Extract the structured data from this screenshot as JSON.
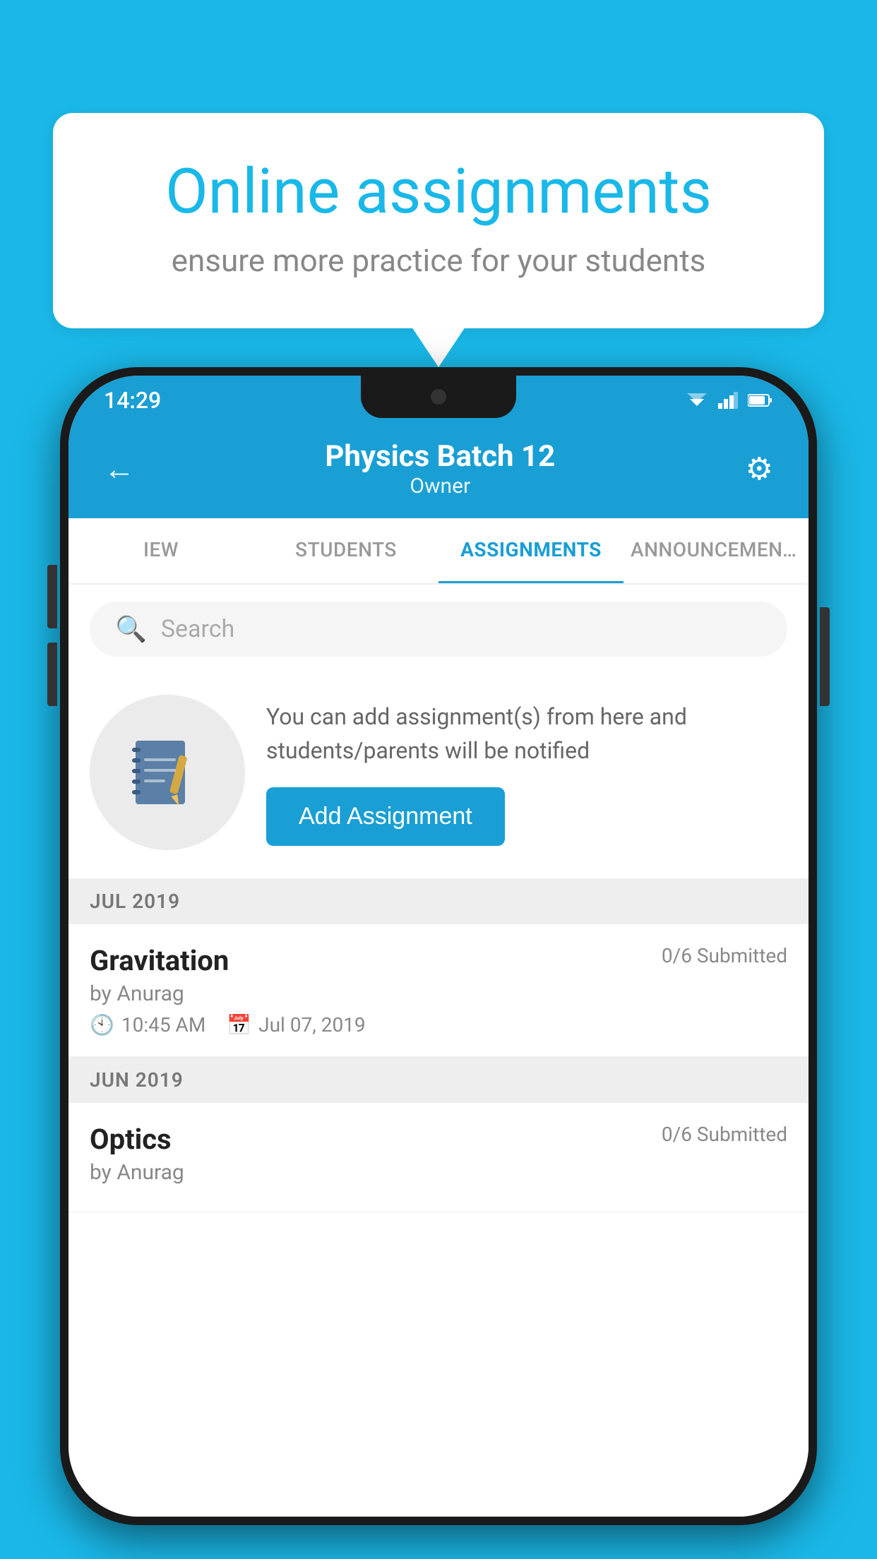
{
  "background": {
    "color": "#1ab8e8"
  },
  "speech_bubble": {
    "title": "Online assignments",
    "subtitle": "ensure more practice for your students"
  },
  "status_bar": {
    "time": "14:29"
  },
  "app_header": {
    "title": "Physics Batch 12",
    "subtitle": "Owner",
    "back_label": "←",
    "settings_label": "⚙"
  },
  "tabs": [
    {
      "label": "IEW",
      "active": false
    },
    {
      "label": "STUDENTS",
      "active": false
    },
    {
      "label": "ASSIGNMENTS",
      "active": true
    },
    {
      "label": "ANNOUNCEMENTS",
      "active": false
    }
  ],
  "search": {
    "placeholder": "Search"
  },
  "promo": {
    "text": "You can add assignment(s) from here and students/parents will be notified",
    "button_label": "Add Assignment"
  },
  "sections": [
    {
      "header": "JUL 2019",
      "assignments": [
        {
          "name": "Gravitation",
          "submitted": "0/6 Submitted",
          "by": "by Anurag",
          "time": "10:45 AM",
          "date": "Jul 07, 2019"
        }
      ]
    },
    {
      "header": "JUN 2019",
      "assignments": [
        {
          "name": "Optics",
          "submitted": "0/6 Submitted",
          "by": "by Anurag",
          "time": "",
          "date": ""
        }
      ]
    }
  ]
}
